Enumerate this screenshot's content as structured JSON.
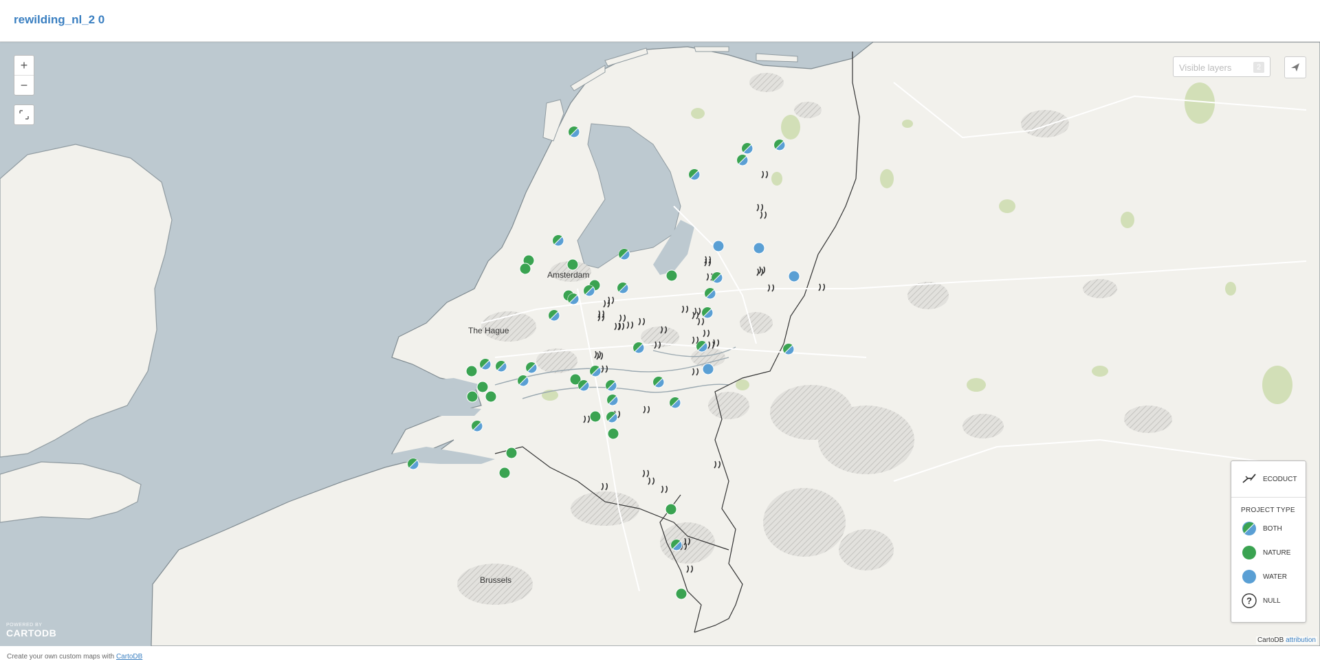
{
  "header": {
    "title": "rewilding_nl_2 0"
  },
  "map": {
    "zoom_in_label": "+",
    "zoom_out_label": "−",
    "cities": [
      {
        "name": "Amsterdam"
      },
      {
        "name": "The Hague"
      },
      {
        "name": "Brussels"
      }
    ]
  },
  "layer_selector": {
    "placeholder": "Visible layers",
    "count": "2"
  },
  "legend": {
    "ecoduct_label": "ECODUCT",
    "project_type_title": "PROJECT TYPE",
    "items": [
      {
        "label": "BOTH",
        "color": "#3aa351",
        "color2": "#5a9fd4"
      },
      {
        "label": "NATURE",
        "color": "#3aa351"
      },
      {
        "label": "WATER",
        "color": "#5a9fd4"
      },
      {
        "label": "NULL",
        "icon": "question-icon"
      }
    ]
  },
  "logo": {
    "powered_by": "POWERED BY",
    "brand": "CARTODB"
  },
  "attribution": {
    "text": "CartoDB",
    "link": "attribution"
  },
  "footer": {
    "text": "Create your own custom maps with",
    "link": "CartoDB"
  }
}
